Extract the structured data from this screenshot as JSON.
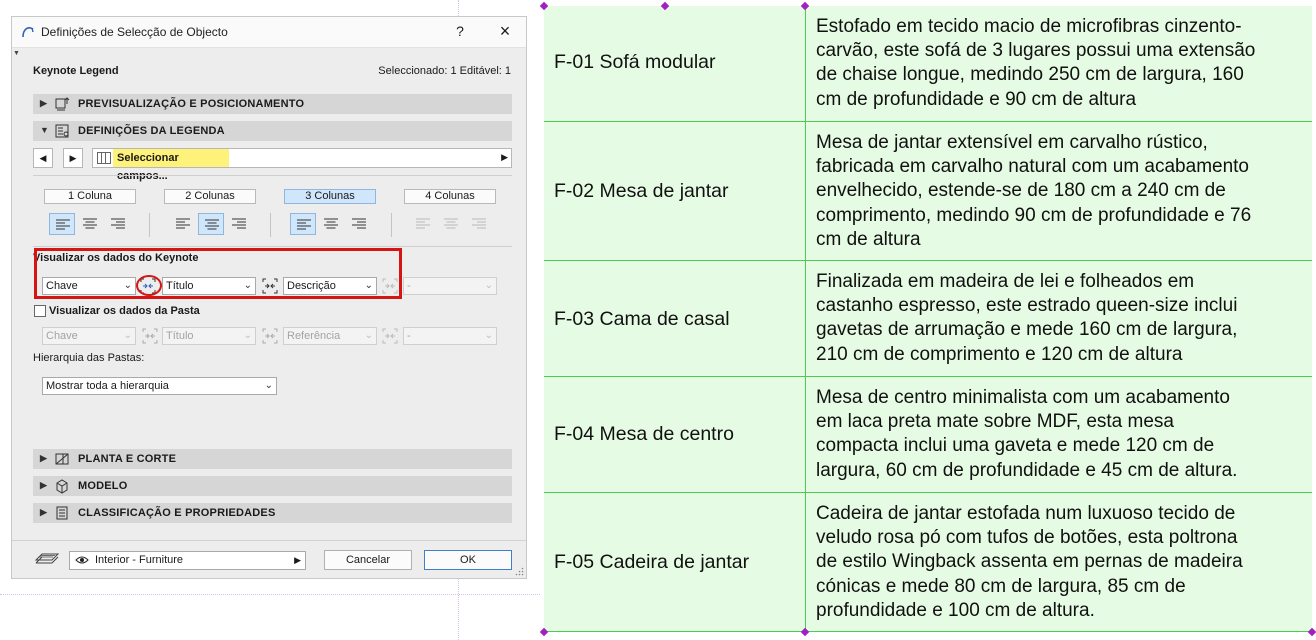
{
  "dialog": {
    "title": "Definições de Selecção de Objecto",
    "help_label": "?",
    "close_label": "×",
    "object_name": "Keynote Legend",
    "selection_info": "Seleccionado: 1 Editável: 1",
    "sections": {
      "preview": "PREVISUALIZAÇÃO E POSICIONAMENTO",
      "legend_settings": "DEFINIÇÕES DA LEGENDA",
      "plan_section": "PLANTA E CORTE",
      "model": "MODELO",
      "classification": "CLASSIFICAÇÃO E PROPRIEDADES"
    },
    "field_selector": "Seleccionar campos...",
    "columns": [
      "1 Coluna",
      "2 Colunas",
      "3 Colunas",
      "4 Colunas"
    ],
    "selected_column": "3 Colunas",
    "keynote_group": {
      "label": "Visualizar os dados do Keynote",
      "fields": [
        "Chave",
        "Título",
        "Descrição",
        "-"
      ]
    },
    "folder_group": {
      "label": "Visualizar os dados da Pasta",
      "checked": false,
      "fields": [
        "Chave",
        "Título",
        "Referência",
        "-"
      ]
    },
    "hierarchy": {
      "label": "Hierarquia das Pastas:",
      "value": "Mostrar toda a hierarquia"
    },
    "layer": "Interior - Furniture",
    "cancel_label": "Cancelar",
    "ok_label": "OK"
  },
  "legend": {
    "border_color": "#4ccd52",
    "background_color": "#e6fbe4",
    "rows": [
      {
        "key": "F-01 Sofá modular",
        "lines": [
          "Estofado em tecido macio de microfibras cinzento-",
          "carvão, este sofá de 3 lugares possui uma extensão",
          "de chaise longue, medindo 250 cm de largura, 160",
          "cm de profundidade e 90 cm de altura"
        ]
      },
      {
        "key": "F-02 Mesa de jantar",
        "lines": [
          "Mesa de jantar extensível em carvalho rústico,",
          "fabricada em carvalho natural com um acabamento",
          "envelhecido, estende-se de 180 cm a 240 cm de",
          "comprimento, medindo 90 cm de profundidade e 76",
          "cm de altura"
        ]
      },
      {
        "key": "F-03 Cama de casal",
        "lines": [
          "Finalizada em madeira de lei e folheados em",
          "castanho espresso, este estrado queen-size inclui",
          "gavetas de arrumação e mede 160 cm de largura,",
          "210 cm de comprimento e 120 cm de altura"
        ]
      },
      {
        "key": "F-04 Mesa de centro",
        "lines": [
          "Mesa de centro minimalista com um acabamento",
          "em laca preta mate sobre MDF, esta mesa",
          "compacta inclui uma gaveta e mede 120 cm de",
          "largura, 60 cm de profundidade e 45 cm de altura."
        ]
      },
      {
        "key": "F-05 Cadeira de jantar",
        "lines": [
          "Cadeira de jantar estofada num luxuoso tecido de",
          "veludo rosa pó com tufos de botões, esta poltrona",
          "de estilo Wingback assenta em pernas de madeira",
          "cónicas e mede 80 cm de largura, 85 cm de",
          "profundidade e 100 cm de altura."
        ]
      }
    ]
  }
}
